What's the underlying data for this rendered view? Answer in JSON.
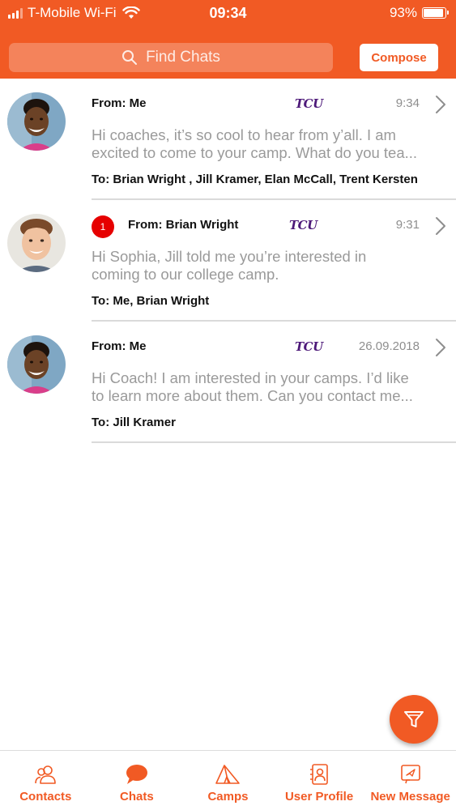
{
  "status_bar": {
    "carrier": "T-Mobile Wi-Fi",
    "time": "09:34",
    "battery": "93%",
    "battery_level": 0.93
  },
  "header": {
    "search_placeholder": "Find Chats",
    "compose_label": "Compose"
  },
  "chats": [
    {
      "from": "From: Me",
      "team": "TCU",
      "time": "9:34",
      "badge": "",
      "preview_line1": "Hi coaches, it’s so cool to hear from y’all. I am",
      "preview_line2": "excited to come to your camp. What do you tea...",
      "to": "To: Brian Wright , Jill Kramer, Elan McCall, Trent Kersten",
      "avatar": "girl-avatar"
    },
    {
      "from": "From: Brian Wright",
      "team": "TCU",
      "time": "9:31",
      "badge": "1",
      "preview_line1": "Hi Sophia, Jill told me you’re interested in",
      "preview_line2": "coming to our college camp.",
      "to": "To: Me, Brian Wright",
      "avatar": "man-avatar"
    },
    {
      "from": "From: Me",
      "team": "TCU",
      "time": "26.09.2018",
      "badge": "",
      "preview_line1": "Hi Coach! I am interested in your camps. I’d like",
      "preview_line2": "to learn more about them. Can you contact me...",
      "to": "To: Jill Kramer",
      "avatar": "girl-avatar"
    }
  ],
  "tabs": [
    {
      "label": "Contacts",
      "icon": "contacts-icon"
    },
    {
      "label": "Chats",
      "icon": "chat-bubble-icon"
    },
    {
      "label": "Camps",
      "icon": "tent-icon"
    },
    {
      "label": "User Profile",
      "icon": "user-profile-icon"
    },
    {
      "label": "New Message",
      "icon": "new-message-icon"
    }
  ],
  "colors": {
    "brand": "#f15a24",
    "tcu_purple": "#4d1979",
    "badge_red": "#e60000"
  }
}
